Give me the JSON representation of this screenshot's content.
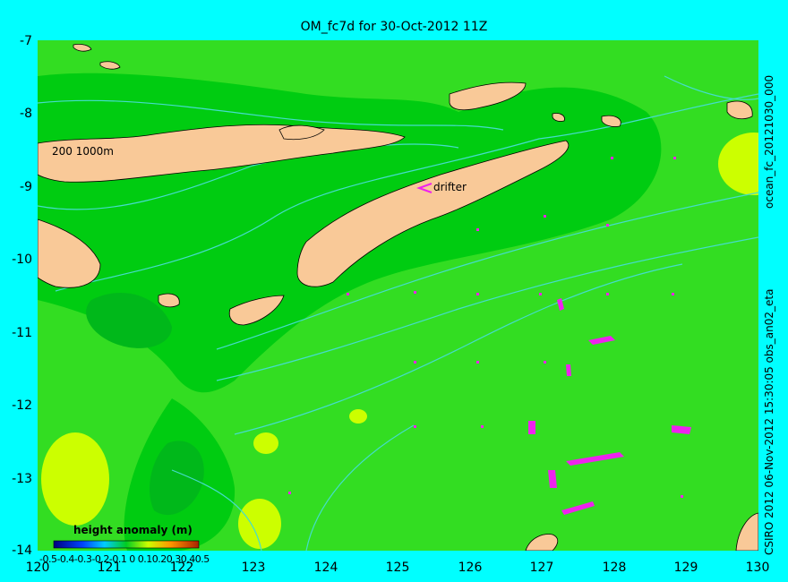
{
  "title": "OM_fc7d for 30-Oct-2012 11Z",
  "y_ticks": [
    "-7",
    "-8",
    "-9",
    "-10",
    "-11",
    "-12",
    "-13",
    "-14"
  ],
  "x_ticks": [
    "120",
    "121",
    "122",
    "123",
    "124",
    "125",
    "126",
    "127",
    "128",
    "129",
    "130"
  ],
  "contour_label": "200  1000m",
  "drifter_label": "drifter",
  "side_text_top": "ocean_fc_20121030_000",
  "side_text_bottom": "CSIRO 2012  06-Nov-2012 15:30:05 obs_an02_eta",
  "legend": {
    "title": "height anomaly (m)",
    "ticks": "-0.5-0.4-0.3-0.2-0.1 0 0.10.20.30.40.5",
    "min": -0.5,
    "max": 0.5
  },
  "colors": {
    "background": "#00ffff",
    "land": "#f9c998",
    "sea_mid": "#33dd22",
    "sea_green": "#00cc11",
    "sea_dark": "#00b81a",
    "sea_yellow": "#ccff00",
    "contour": "#44ddcc",
    "obs": "#ee22ee"
  },
  "extent": {
    "lon": [
      120,
      130
    ],
    "lat": [
      -14,
      -7
    ]
  }
}
